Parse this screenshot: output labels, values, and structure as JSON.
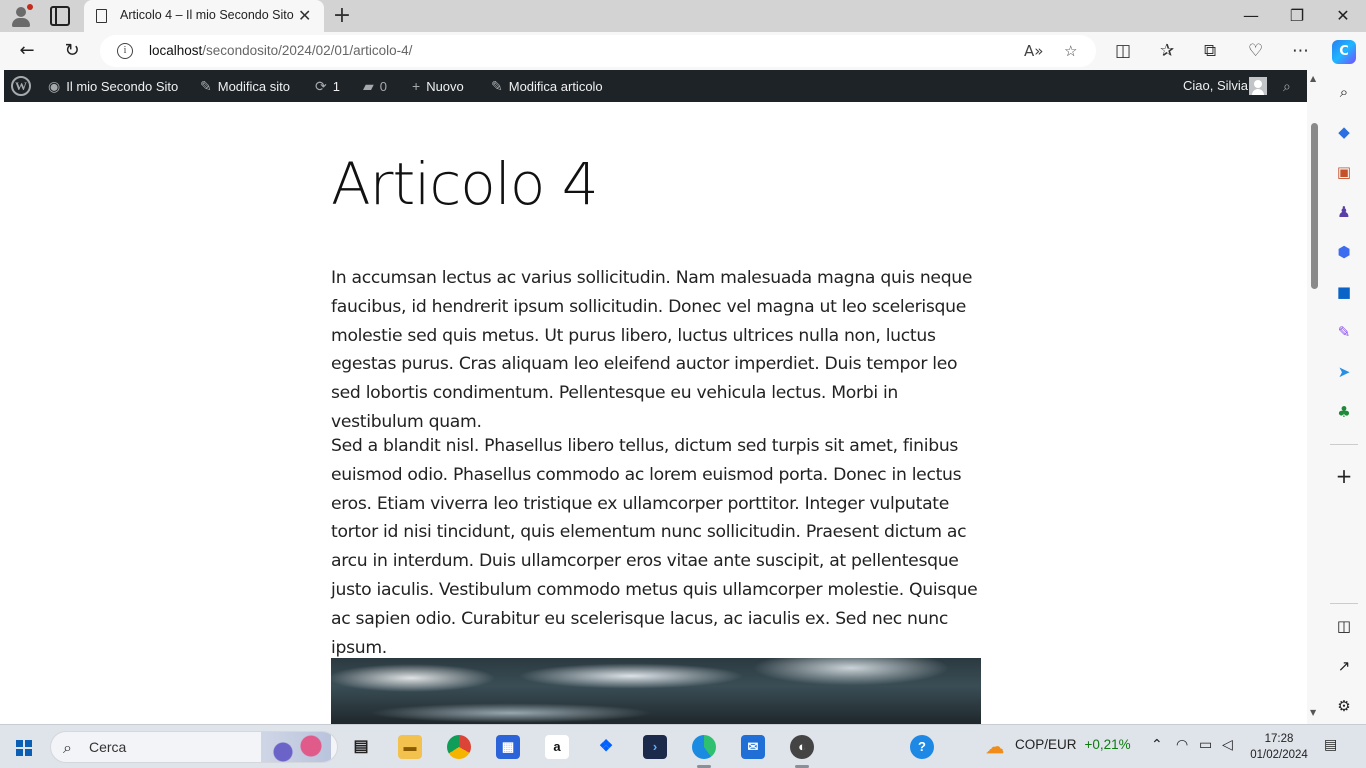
{
  "browser": {
    "tab_title": "Articolo 4 – Il mio Secondo Sito",
    "url_host": "localhost",
    "url_path": "/secondosito/2024/02/01/articolo-4/"
  },
  "admin_bar": {
    "site_name": "Il mio Secondo Sito",
    "customize": "Modifica sito",
    "updates_count": "1",
    "comments_count": "0",
    "new": "Nuovo",
    "edit_post": "Modifica articolo",
    "greeting": "Ciao, Silvia"
  },
  "post": {
    "title": "Articolo 4",
    "paragraphs": [
      "In accumsan lectus ac varius sollicitudin. Nam malesuada magna quis neque faucibus, id hendrerit ipsum sollicitudin. Donec vel magna ut leo scelerisque molestie sed quis metus. Ut purus libero, luctus ultrices nulla non, luctus egestas purus. Cras aliquam leo eleifend auctor imperdiet. Duis tempor leo sed lobortis condimentum. Pellentesque eu vehicula lectus. Morbi in vestibulum quam.",
      "Sed a blandit nisl. Phasellus libero tellus, dictum sed turpis sit amet, finibus euismod odio. Phasellus commodo ac lorem euismod porta. Donec in lectus eros. Etiam viverra leo tristique ex ullamcorper porttitor. Integer vulputate tortor id nisi tincidunt, quis elementum nunc sollicitudin. Praesent dictum ac arcu in interdum. Duis ullamcorper eros vitae ante suscipit, at pellentesque justo iaculis. Vestibulum commodo metus quis ullamcorper molestie. Quisque ac sapien odio. Curabitur eu scelerisque lacus, ac iaculis ex. Sed nec nunc ipsum."
    ]
  },
  "taskbar": {
    "search_label": "Cerca",
    "ticker_name": "COP/EUR",
    "ticker_change": "+0,21%",
    "time": "17:28",
    "date": "01/02/2024"
  },
  "colors": {
    "admin_bar": "#1d2327",
    "ticker_positive": "#0f7b0f"
  }
}
